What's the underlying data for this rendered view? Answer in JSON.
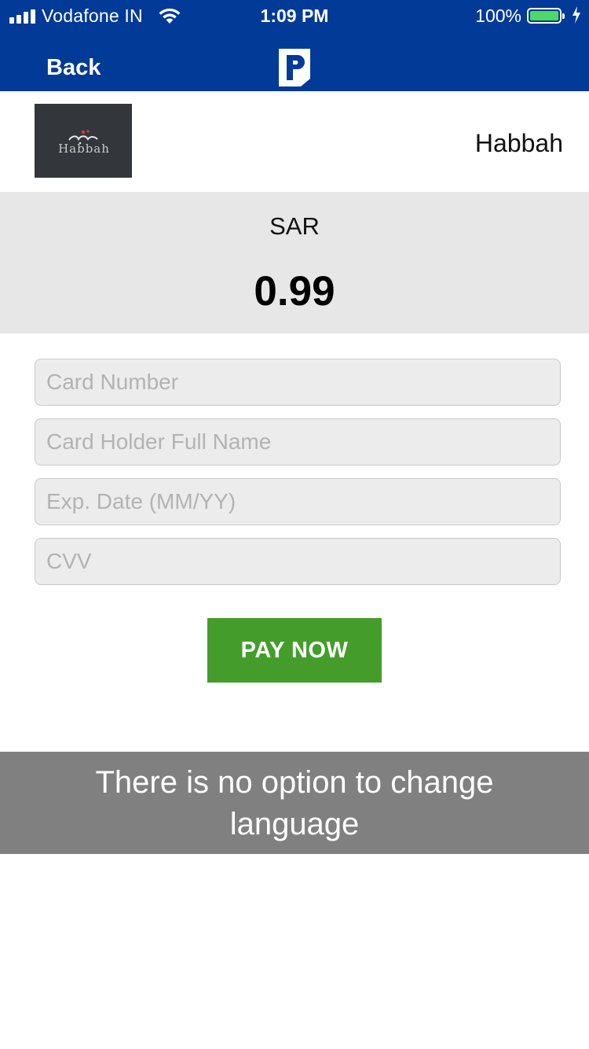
{
  "status_bar": {
    "carrier": "Vodafone IN",
    "time": "1:09 PM",
    "battery_percent": "100%",
    "signal_bars": 4,
    "battery_level": 1.0,
    "charging": true
  },
  "nav": {
    "back_label": "Back",
    "logo_icon": "p-brand-logo-icon"
  },
  "merchant": {
    "logo_text": "Habbah",
    "name": "Habbah"
  },
  "amount": {
    "currency": "SAR",
    "value": "0.99"
  },
  "form": {
    "card_number_placeholder": "Card Number",
    "holder_name_placeholder": "Card Holder Full Name",
    "exp_date_placeholder": "Exp. Date (MM/YY)",
    "cvv_placeholder": "CVV",
    "pay_button_label": "PAY NOW"
  },
  "toast": {
    "message": "There is no option to change language"
  },
  "colors": {
    "header_blue": "#023a97",
    "pay_green": "#449d2a",
    "amount_panel_gray": "#e7e7e7",
    "toast_gray": "#808080",
    "battery_green": "#4cd964"
  }
}
